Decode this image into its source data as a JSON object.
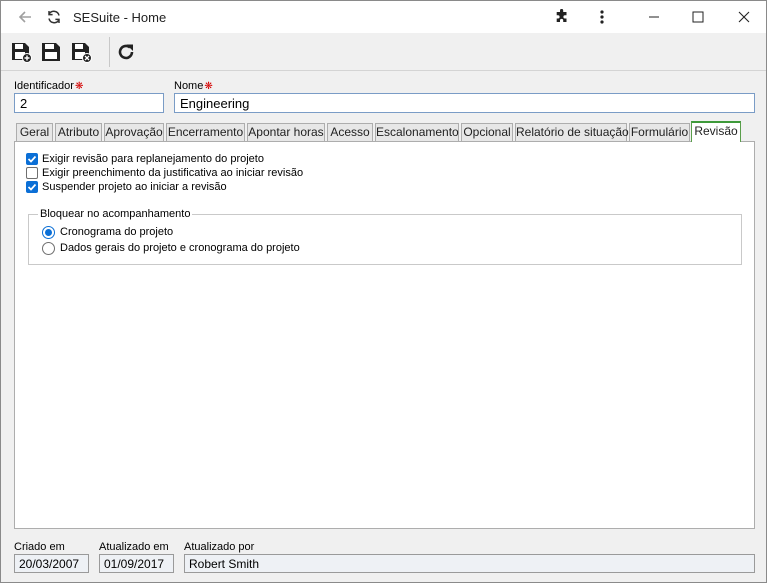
{
  "window": {
    "title": "SESuite - Home"
  },
  "toolbar": {
    "buttons": [
      "save-new-icon",
      "save-icon",
      "save-close-icon",
      "refresh-icon"
    ]
  },
  "form": {
    "identificador_label": "Identificador",
    "identificador_value": "2",
    "nome_label": "Nome",
    "nome_value": "Engineering"
  },
  "tabs": [
    {
      "label": "Geral"
    },
    {
      "label": "Atributo"
    },
    {
      "label": "Aprovação"
    },
    {
      "label": "Encerramento"
    },
    {
      "label": "Apontar horas"
    },
    {
      "label": "Acesso"
    },
    {
      "label": "Escalonamento"
    },
    {
      "label": "Opcional"
    },
    {
      "label": "Relatório de situação"
    },
    {
      "label": "Formulário"
    },
    {
      "label": "Revisão"
    }
  ],
  "revisao": {
    "checkboxes": [
      {
        "label": "Exigir revisão para replanejamento do projeto",
        "checked": true
      },
      {
        "label": "Exigir preenchimento da justificativa ao iniciar revisão",
        "checked": false
      },
      {
        "label": "Suspender projeto ao iniciar a revisão",
        "checked": true
      }
    ],
    "group_title": "Bloquear no acompanhamento",
    "radios": [
      {
        "label": "Cronograma do projeto",
        "selected": true
      },
      {
        "label": "Dados gerais do projeto e cronograma do projeto",
        "selected": false
      }
    ]
  },
  "footer": {
    "criado_label": "Criado em",
    "criado_value": "20/03/2007",
    "atualizado_label": "Atualizado em",
    "atualizado_value": "01/09/2017",
    "atualizado_por_label": "Atualizado por",
    "atualizado_por_value": "Robert Smith"
  },
  "colors": {
    "accent": "#0b6fd6",
    "active_tab": "#3e9a3a",
    "required": "#d40000"
  }
}
